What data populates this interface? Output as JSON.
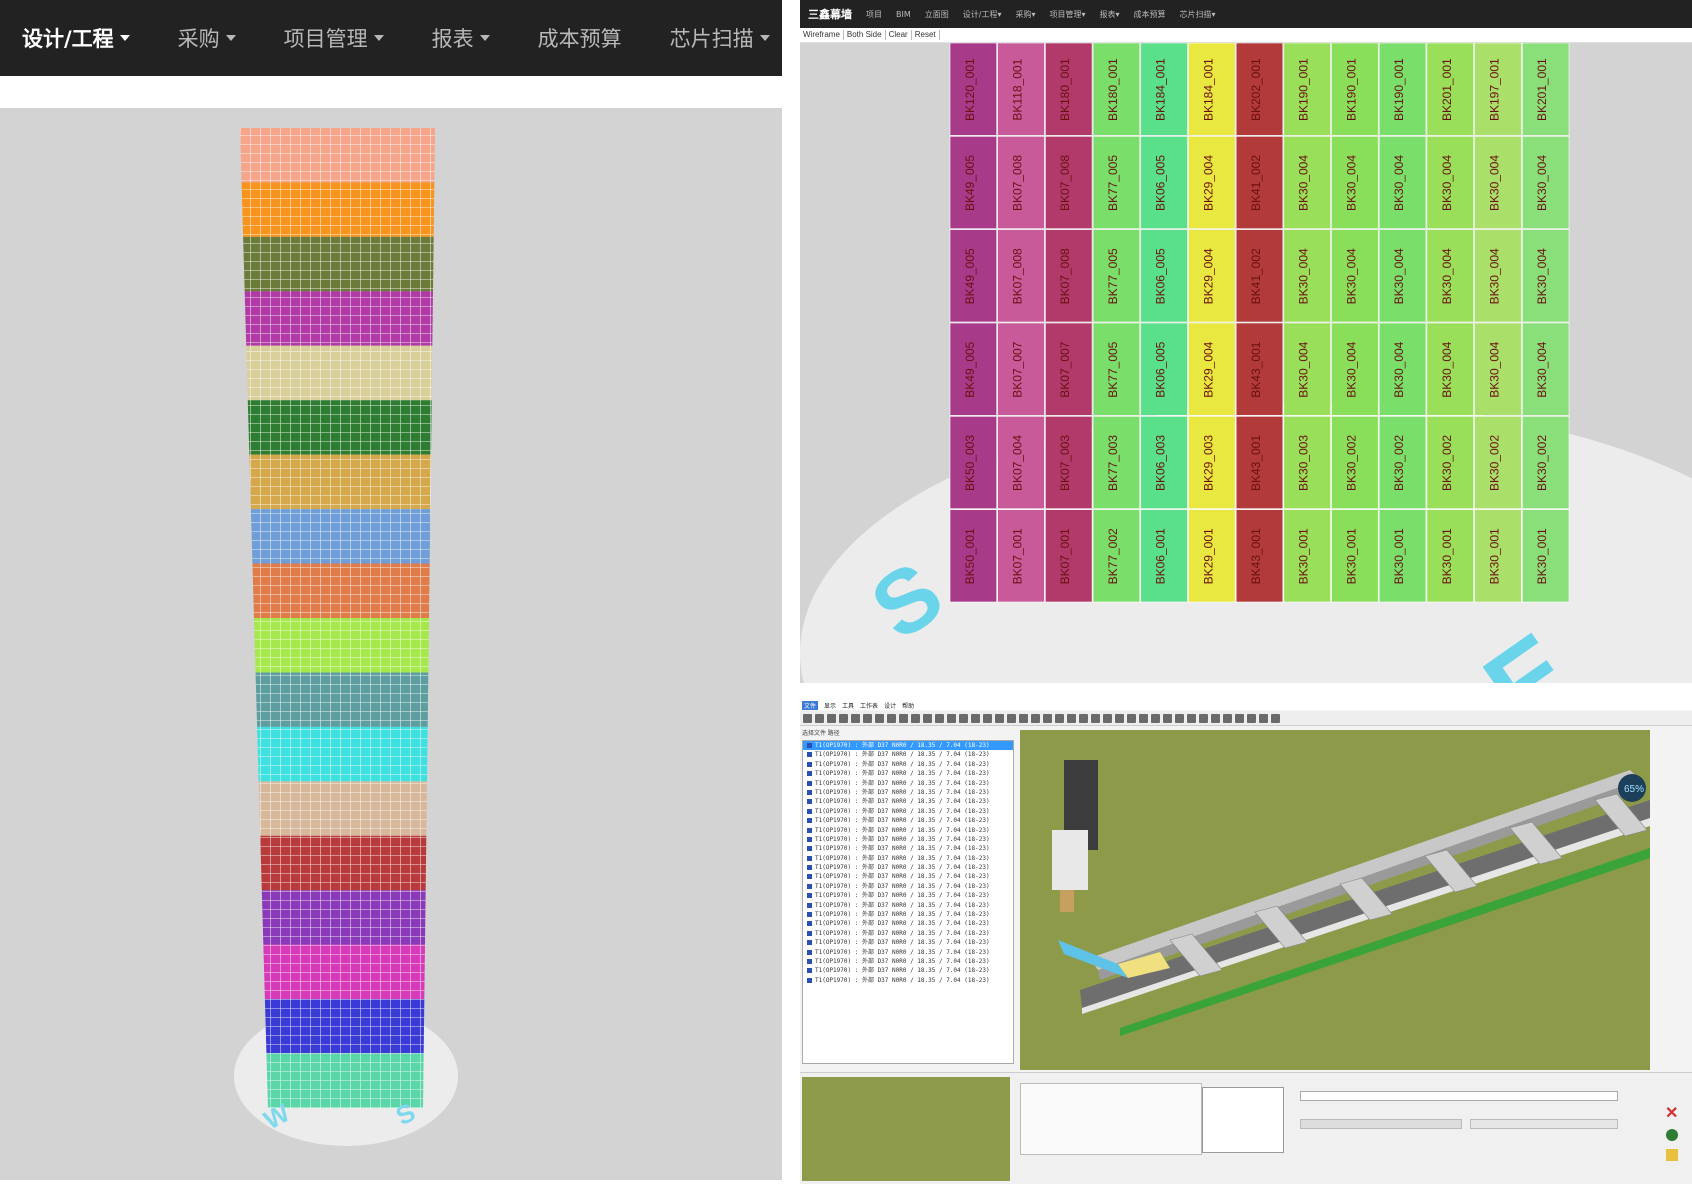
{
  "left_panel": {
    "nav": [
      {
        "label": "设计/工程",
        "dropdown": true,
        "active": true
      },
      {
        "label": "采购",
        "dropdown": true
      },
      {
        "label": "项目管理",
        "dropdown": true
      },
      {
        "label": "报表",
        "dropdown": true
      },
      {
        "label": "成本预算",
        "dropdown": false
      },
      {
        "label": "芯片扫描",
        "dropdown": true
      }
    ],
    "compass": {
      "w": "W",
      "s": "S"
    },
    "band_colors": [
      "#f4a58a",
      "#f7941d",
      "#6b7c3a",
      "#b23aa6",
      "#d9cf9a",
      "#2e7d32",
      "#d4a84b",
      "#6f9ed8",
      "#e07b4a",
      "#a5e84b",
      "#5e9ea0",
      "#3fe0e0",
      "#d8b89a",
      "#b83a3a",
      "#8a3ab8",
      "#d63ab8",
      "#3a3ad6",
      "#5ad6a8"
    ]
  },
  "top_right_panel": {
    "nav": {
      "brand": "三鑫幕墙",
      "items": [
        "项目",
        "BIM",
        "立面图",
        "设计/工程▾",
        "采购▾",
        "项目管理▾",
        "报表▾",
        "成本预算",
        "芯片扫描▾"
      ]
    },
    "tools": [
      "Wireframe",
      "Both Side",
      "Clear",
      "Reset"
    ],
    "compass": {
      "s": "S",
      "e": "E"
    },
    "panel_labels": [
      [
        "BK120_001",
        "BK118_001",
        "BK180_001",
        "BK180_001",
        "BK184_001",
        "BK184_001",
        "BK202_001",
        "BK190_001",
        "BK190_001",
        "BK190_001",
        "BK201_001",
        "BK197_001",
        "BK201_001"
      ],
      [
        "BK49_005",
        "BK07_008",
        "BK07_008",
        "BK77_005",
        "BK06_005",
        "BK29_004",
        "BK41_002",
        "BK30_004",
        "BK30_004",
        "BK30_004",
        "BK30_004",
        "BK30_004",
        "BK30_004"
      ],
      [
        "BK49_005",
        "BK07_008",
        "BK07_008",
        "BK77_005",
        "BK06_005",
        "BK29_004",
        "BK41_002",
        "BK30_004",
        "BK30_004",
        "BK30_004",
        "BK30_004",
        "BK30_004",
        "BK30_004"
      ],
      [
        "BK49_005",
        "BK07_007",
        "BK07_007",
        "BK77_005",
        "BK06_005",
        "BK29_004",
        "BK43_001",
        "BK30_004",
        "BK30_004",
        "BK30_004",
        "BK30_004",
        "BK30_004",
        "BK30_004"
      ],
      [
        "BK50_003",
        "BK07_004",
        "BK07_003",
        "BK77_003",
        "BK06_003",
        "BK29_003",
        "BK43_001",
        "BK30_003",
        "BK30_002",
        "BK30_002",
        "BK30_002",
        "BK30_002",
        "BK30_002"
      ],
      [
        "BK50_001",
        "BK07_001",
        "BK07_001",
        "BK77_002",
        "BK06_001",
        "BK29_001",
        "BK43_001",
        "BK30_001",
        "BK30_001",
        "BK30_001",
        "BK30_001",
        "BK30_001",
        "BK30_001"
      ]
    ],
    "panel_colors": [
      "#a83a8a",
      "#c85a9a",
      "#b23a6a",
      "#7adf6a",
      "#5adf8a",
      "#e8e840",
      "#b23a3a",
      "#9adf5a",
      "#8adf5a",
      "#7adf6a",
      "#9adf5a",
      "#aadf6a",
      "#8adf7a"
    ]
  },
  "bottom_right_panel": {
    "menu": [
      "文件",
      "显示",
      "工具",
      "工作表",
      "设计",
      "帮助"
    ],
    "tree_header": "选择文件  路径",
    "tree_rows": [
      "T1(OP1970) : 外部 D37 N0R0 / 18.35 / 7.04 (18-23)",
      "T1(OP1970) : 外部 D37 N0R0 / 18.35 / 7.04 (18-23)",
      "T1(OP1970) : 外部 D37 N0R0 / 18.35 / 7.04 (18-23)",
      "T1(OP1970) : 外部 D37 N0R0 / 18.35 / 7.04 (18-23)",
      "T1(OP1970) : 外部 D37 N0R0 / 18.35 / 7.04 (18-23)",
      "T1(OP1970) : 外部 D37 N0R0 / 18.35 / 7.04 (18-23)",
      "T1(OP1970) : 外部 D37 N0R0 / 18.35 / 7.04 (18-23)",
      "T1(OP1970) : 外部 D37 N0R0 / 18.35 / 7.04 (18-23)",
      "T1(OP1970) : 外部 D37 N0R0 / 18.35 / 7.04 (18-23)",
      "T1(OP1970) : 外部 D37 N0R0 / 18.35 / 7.04 (18-23)",
      "T1(OP1970) : 外部 D37 N0R0 / 18.35 / 7.04 (18-23)",
      "T1(OP1970) : 外部 D37 N0R0 / 18.35 / 7.04 (18-23)",
      "T1(OP1970) : 外部 D37 N0R0 / 18.35 / 7.04 (18-23)",
      "T1(OP1970) : 外部 D37 N0R0 / 18.35 / 7.04 (18-23)",
      "T1(OP1970) : 外部 D37 N0R0 / 18.35 / 7.04 (18-23)",
      "T1(OP1970) : 外部 D37 N0R0 / 18.35 / 7.04 (18-23)",
      "T1(OP1970) : 外部 D37 N0R0 / 18.35 / 7.04 (18-23)",
      "T1(OP1970) : 外部 D37 N0R0 / 18.35 / 7.04 (18-23)",
      "T1(OP1970) : 外部 D37 N0R0 / 18.35 / 7.04 (18-23)",
      "T1(OP1970) : 外部 D37 N0R0 / 18.35 / 7.04 (18-23)",
      "T1(OP1970) : 外部 D37 N0R0 / 18.35 / 7.04 (18-23)",
      "T1(OP1970) : 外部 D37 N0R0 / 18.35 / 7.04 (18-23)",
      "T1(OP1970) : 外部 D37 N0R0 / 18.35 / 7.04 (18-23)",
      "T1(OP1970) : 外部 D37 N0R0 / 18.35 / 7.04 (18-23)",
      "T1(OP1970) : 外部 D37 N0R0 / 18.35 / 7.04 (18-23)",
      "T1(OP1970) : 外部 D37 N0R0 / 18.35 / 7.04 (18-23)"
    ],
    "progress_badge": "65%",
    "status_colors": {
      "close": "#d32f2f",
      "info": "#2e7d32"
    }
  }
}
